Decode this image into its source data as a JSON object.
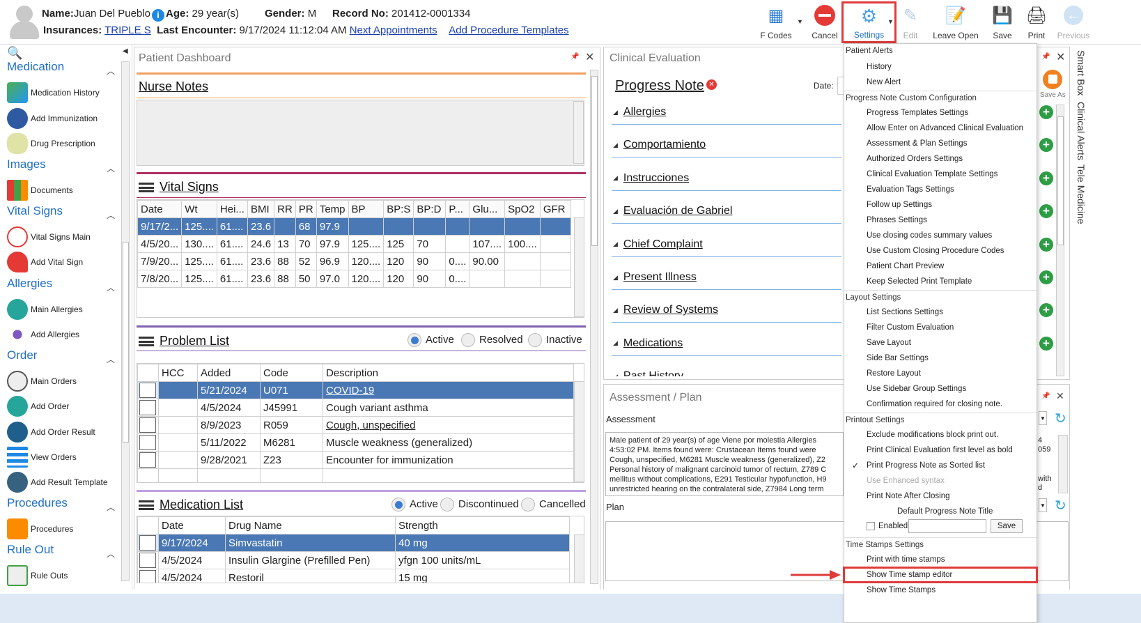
{
  "patient": {
    "name_label": "Name:",
    "name": "Juan Del Pueblo",
    "info_icon": "i",
    "age_label": "Age:",
    "age": "29 year(s)",
    "gender_label": "Gender:",
    "gender": "M",
    "record_label": "Record No:",
    "record": "201412-0001334",
    "ins_label": "Insurances:",
    "insurance": "TRIPLE S",
    "last_label": "Last Encounter:",
    "last": "9/17/2024 11:12:04 AM",
    "next_appt": "Next Appointments",
    "add_proc": "Add Procedure Templates"
  },
  "toolbar": {
    "fcodes": "F Codes",
    "cancel": "Cancel",
    "settings": "Settings",
    "edit": "Edit",
    "leave_open": "Leave Open",
    "save": "Save",
    "print": "Print",
    "previous": "Previous"
  },
  "nav": {
    "medication": "Medication",
    "med_history": "Medication History",
    "add_immunization": "Add Immunization",
    "drug_prescription": "Drug Prescription",
    "images": "Images",
    "documents": "Documents",
    "vital_signs": "Vital Signs",
    "vital_main": "Vital Signs Main",
    "add_vital": "Add Vital Sign",
    "allergies": "Allergies",
    "main_allergies": "Main Allergies",
    "add_allergies": "Add Allergies",
    "order": "Order",
    "main_orders": "Main Orders",
    "add_order": "Add Order",
    "add_order_result": "Add Order Result",
    "view_orders": "View Orders",
    "add_result_template": "Add Result Template",
    "procedures": "Procedures",
    "procedures_item": "Procedures",
    "rule_out": "Rule Out",
    "rule_outs": "Rule Outs"
  },
  "dashboard": {
    "title": "Patient Dashboard",
    "nurse_notes": "Nurse Notes",
    "vital_signs": "Vital Signs",
    "vital_headers": [
      "Date",
      "Wt",
      "Hei...",
      "BMI",
      "RR",
      "PR",
      "Temp",
      "BP",
      "BP:S",
      "BP:D",
      "P...",
      "Glu...",
      "SpO2",
      "GFR"
    ],
    "vital_rows": [
      [
        "9/17/2...",
        "125....",
        "61....",
        "23.6",
        "",
        "68",
        "97.9",
        "",
        "",
        "",
        "",
        "",
        "",
        ""
      ],
      [
        "4/5/20...",
        "130....",
        "61....",
        "24.6",
        "13",
        "70",
        "97.9",
        "125....",
        "125",
        "70",
        "",
        "107....",
        "100....",
        ""
      ],
      [
        "7/9/20...",
        "125....",
        "61....",
        "23.6",
        "88",
        "52",
        "96.9",
        "120....",
        "120",
        "90",
        "0....",
        "90.00",
        "",
        ""
      ],
      [
        "7/8/20...",
        "125....",
        "61....",
        "23.6",
        "88",
        "50",
        "97.0",
        "120....",
        "120",
        "90",
        "0....",
        "",
        "",
        ""
      ]
    ],
    "problem_list": "Problem List",
    "pl_active": "Active",
    "pl_resolved": "Resolved",
    "pl_inactive": "Inactive",
    "problem_headers": [
      "HCC",
      "Added",
      "Code",
      "Description"
    ],
    "problem_rows": [
      [
        "",
        "5/21/2024",
        "U071",
        "COVID-19"
      ],
      [
        "",
        "4/5/2024",
        "J45991",
        "Cough variant asthma"
      ],
      [
        "",
        "8/9/2023",
        "R059",
        "Cough, unspecified"
      ],
      [
        "",
        "5/11/2022",
        "M6281",
        "Muscle weakness (generalized)"
      ],
      [
        "",
        "9/28/2021",
        "Z23",
        "Encounter for immunization"
      ]
    ],
    "medication_list": "Medication List",
    "ml_active": "Active",
    "ml_discontinued": "Discontinued",
    "ml_cancelled": "Cancelled",
    "med_headers": [
      "Date",
      "Drug Name",
      "Strength"
    ],
    "med_rows": [
      [
        "9/17/2024",
        "Simvastatin",
        "40 mg"
      ],
      [
        "4/5/2024",
        "Insulin Glargine (Prefilled Pen)",
        "yfgn 100 units/mL"
      ],
      [
        "4/5/2024",
        "Restoril",
        "15 mg"
      ]
    ]
  },
  "clinical": {
    "title": "Clinical Evaluation",
    "progress_note": "Progress Note",
    "date_label": "Date:",
    "sections": [
      "Allergies",
      "Comportamiento",
      "Instrucciones",
      "Evaluación de Gabriel",
      "Chief Complaint",
      "Present Illness",
      "Review of Systems",
      "Medications",
      "Past History"
    ],
    "save_as": "Save As"
  },
  "assessment": {
    "title": "Assessment / Plan",
    "assessment_label": "Assessment",
    "text_lines": [
      "Male patient of 29 year(s) of age Viene por molestia    Allergies",
      "4:53:02 PM.   Items found were:  Crustacean  Items found were",
      "Cough, unspecified, M6281 Muscle weakness (generalized), Z2",
      "Personal history of malignant carcinoid tumor of rectum, Z789 C",
      "mellitus without complications, E291 Testicular hypofunction, H9",
      "unrestricted hearing on the contralateral side, Z7984 Long term"
    ],
    "right_frag1": "4",
    "right_frag2": "059",
    "right_frag3": "with",
    "right_frag4": "d",
    "plan_label": "Plan"
  },
  "side_tabs": [
    "Smart Box",
    "Clinical Alerts",
    "Tele Medicine"
  ],
  "menu": {
    "patient_alerts": "Patient Alerts",
    "history": "History",
    "new_alert": "New Alert",
    "pn_config": "Progress Note Custom Configuration",
    "pn_items": [
      "Progress Templates Settings",
      "Allow Enter on Advanced Clinical Evaluation",
      "Assessment & Plan Settings",
      "Authorized Orders Settings",
      "Clinical Evaluation Template Settings",
      "Evaluation Tags Settings",
      "Follow up Settings",
      "Phrases Settings",
      "Use closing codes summary values",
      "Use Custom Closing Procedure Codes",
      "Patient Chart Preview",
      "Keep Selected Print Template"
    ],
    "layout_settings": "Layout Settings",
    "layout_items": [
      "List Sections Settings",
      "Filter Custom Evaluation",
      "Save Layout",
      "Side Bar Settings",
      "Restore Layout",
      "Use Sidebar Group Settings",
      "Confirmation required for closing note."
    ],
    "printout_settings": "Printout Settings",
    "print_items": [
      "Exclude modifications block print out.",
      "Print Clinical Evaluation first level as bold",
      "Print Progress Note as Sorted list",
      "Use Enhanced syntax",
      "Print Note After Closing"
    ],
    "default_title": "Default Progress Note Title",
    "enabled": "Enabled",
    "save": "Save",
    "time_stamps": "Time Stamps Settings",
    "ts_items": [
      "Print with time stamps",
      "Show Time stamp editor",
      "Show Time Stamps"
    ],
    "check": "✓"
  }
}
